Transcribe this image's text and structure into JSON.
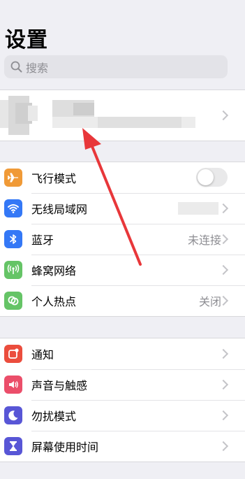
{
  "header": {
    "title": "设置"
  },
  "search": {
    "placeholder": "搜索"
  },
  "group1": [
    {
      "label": "飞行模式",
      "value": "",
      "control": "toggle",
      "toggle_on": false,
      "icon": "airplane-icon",
      "color": "#f09a37"
    },
    {
      "label": "无线局域网",
      "value": "",
      "icon": "wifi-icon",
      "color": "#3478f6"
    },
    {
      "label": "蓝牙",
      "value": "未连接",
      "icon": "bluetooth-icon",
      "color": "#3478f6"
    },
    {
      "label": "蜂窝网络",
      "value": "",
      "icon": "cellular-icon",
      "color": "#65c466"
    },
    {
      "label": "个人热点",
      "value": "关闭",
      "icon": "hotspot-icon",
      "color": "#65c466"
    }
  ],
  "group2": [
    {
      "label": "通知",
      "value": "",
      "icon": "notifications-icon",
      "color": "#eb4d3d"
    },
    {
      "label": "声音与触感",
      "value": "",
      "icon": "sound-icon",
      "color": "#eb4e6a"
    },
    {
      "label": "勿扰模式",
      "value": "",
      "icon": "moon-icon",
      "color": "#5856d6"
    },
    {
      "label": "屏幕使用时间",
      "value": "",
      "icon": "hourglass-icon",
      "color": "#5856d6"
    }
  ],
  "colors": {
    "background": "#efeff4",
    "arrow": "#e8373a",
    "secondary_text": "#8e8e93"
  }
}
